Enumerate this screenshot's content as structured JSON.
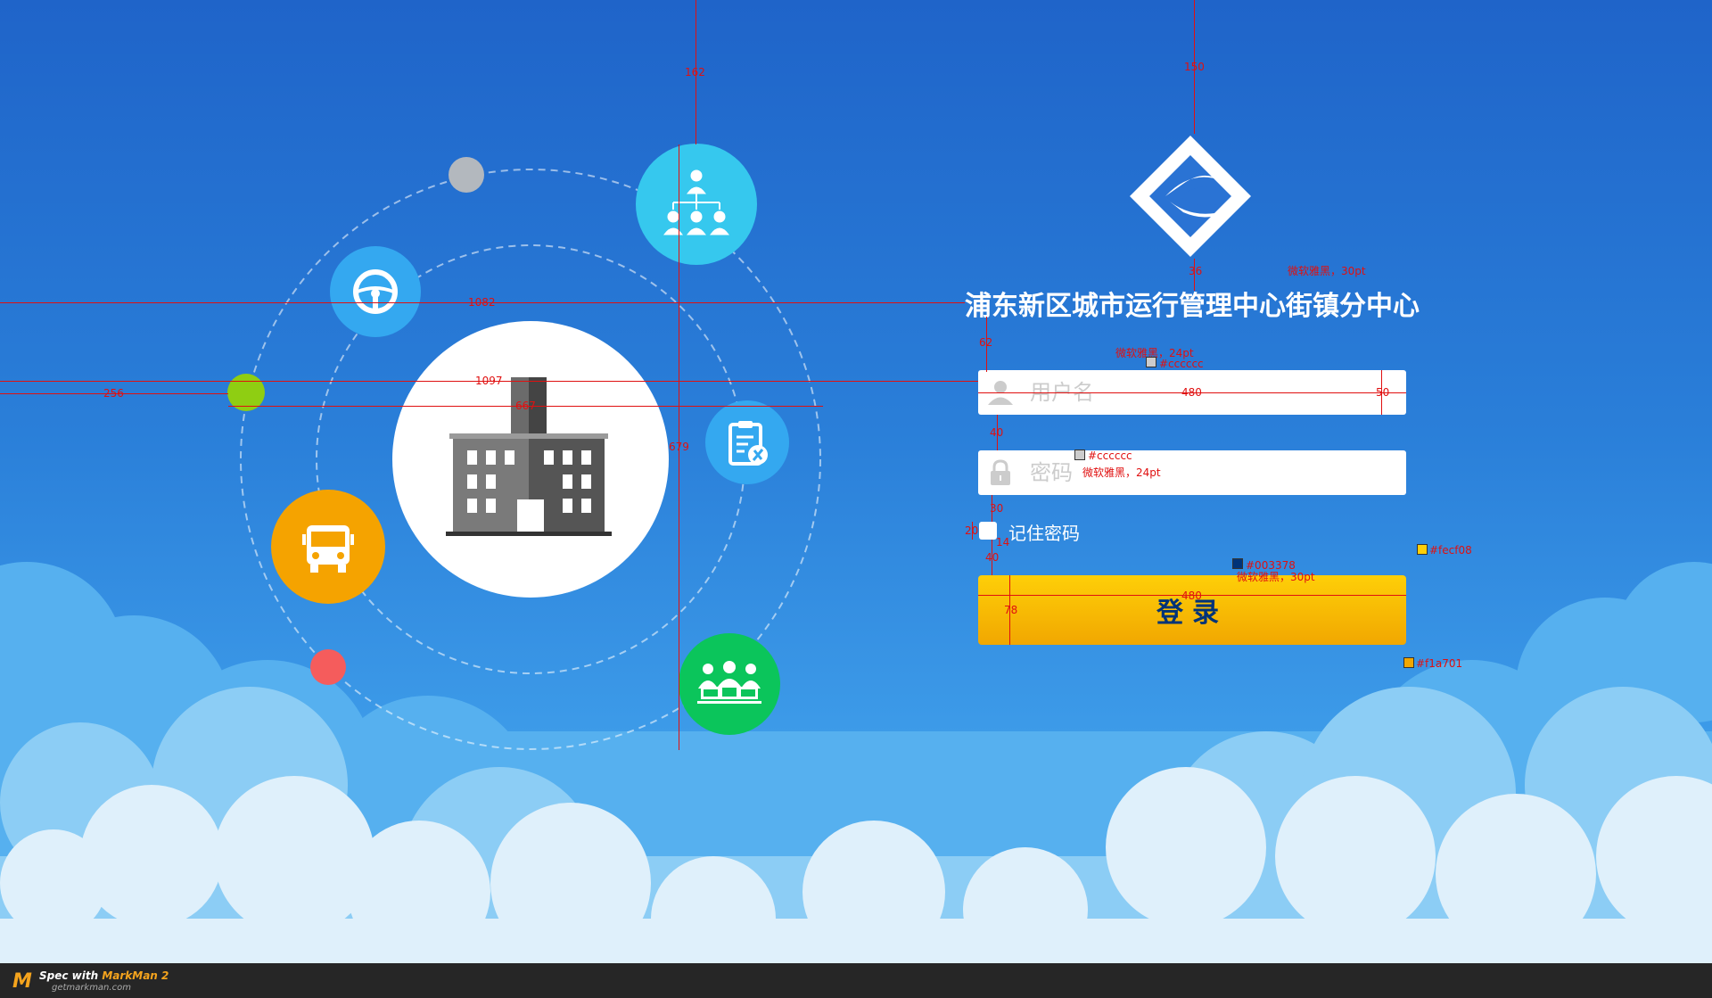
{
  "app": {
    "title": "浦东新区城市运行管理中心街镇分中心"
  },
  "login_form": {
    "username_placeholder": "用户名",
    "password_placeholder": "密码",
    "remember_label": "记住密码",
    "login_label": "登录"
  },
  "icons": {
    "logo": "app-logo-icon",
    "user": "user-icon",
    "lock": "lock-icon",
    "org": "org-chart-icon",
    "wheel": "steering-wheel-icon",
    "building": "building-icon",
    "clipboard": "clipboard-tools-icon",
    "bus": "bus-icon",
    "meeting": "meeting-icon"
  },
  "colors": {
    "button_top": "#fecf08",
    "button_bottom": "#f1a701",
    "button_text": "#003378",
    "placeholder": "#cccccc"
  },
  "spec": {
    "dims": {
      "d162": "162",
      "d150": "150",
      "d36": "36",
      "d1082": "1082",
      "d62": "62",
      "d1097": "1097",
      "d256": "256",
      "d667": "667",
      "d679": "679",
      "d480a": "480",
      "d50": "50",
      "d40a": "40",
      "d30": "30",
      "d20": "20",
      "d14": "14",
      "d40b": "40",
      "d480b": "480",
      "d78": "78"
    },
    "notes": {
      "title_font": "微软雅黑，30pt",
      "user_font": "微软雅黑，24pt",
      "user_color": "#cccccc",
      "pwd_color": "#cccccc",
      "pwd_font": "微软雅黑，24pt",
      "btn_text_color": "#003378",
      "btn_font": "微软雅黑，30pt",
      "btn_top_color": "#fecf08",
      "btn_bottom_color": "#f1a701"
    }
  },
  "footer": {
    "brand_prefix": "Spec with ",
    "brand_name": "MarkMan 2",
    "site": "getmarkman.com"
  }
}
